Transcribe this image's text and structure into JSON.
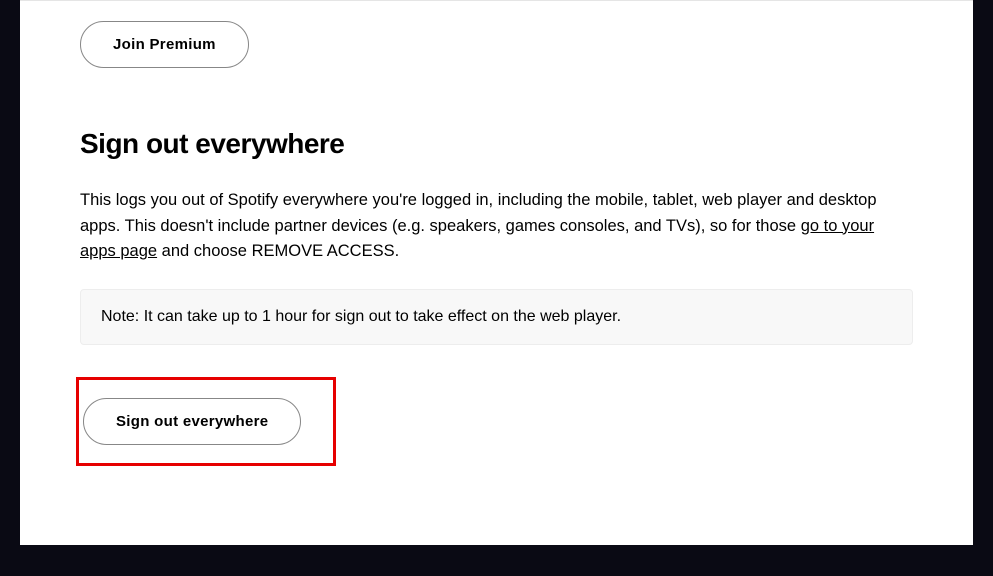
{
  "buttons": {
    "join_premium": "Join Premium",
    "sign_out_everywhere": "Sign out everywhere"
  },
  "section": {
    "heading": "Sign out everywhere",
    "description_part1": "This logs you out of Spotify everywhere you're logged in, including the mobile, tablet, web player and desktop apps. This doesn't include partner devices (e.g. speakers, games consoles, and TVs), so for those ",
    "link_text": "go to your apps page",
    "description_part2": " and choose REMOVE ACCESS.",
    "note": "Note: It can take up to 1 hour for sign out to take effect on the web player."
  }
}
